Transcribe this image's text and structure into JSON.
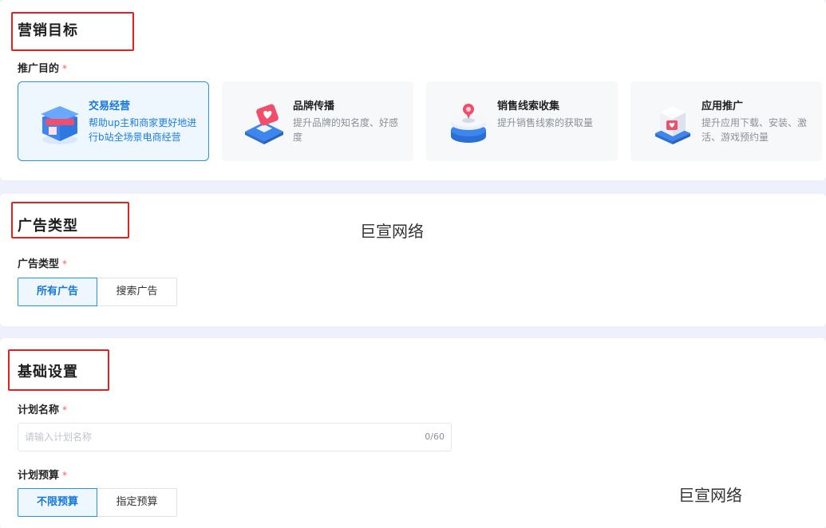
{
  "goal_section": {
    "title": "营销目标",
    "field_label": "推广目的",
    "required_mark": "*",
    "options": [
      {
        "title": "交易经营",
        "desc": "帮助up主和商家更好地进行b站全场景电商经营",
        "selected": true,
        "icon": "box-store-icon"
      },
      {
        "title": "品牌传播",
        "desc": "提升品牌的知名度、好感度",
        "selected": false,
        "icon": "heart-badge-icon"
      },
      {
        "title": "销售线索收集",
        "desc": "提升销售线索的获取量",
        "selected": false,
        "icon": "location-stack-icon"
      },
      {
        "title": "应用推广",
        "desc": "提升应用下载、安装、激活、游戏预约量",
        "selected": false,
        "icon": "app-cube-icon"
      }
    ]
  },
  "type_section": {
    "title": "广告类型",
    "field_label": "广告类型",
    "required_mark": "*",
    "options": [
      "所有广告",
      "搜索广告"
    ],
    "selected": "所有广告"
  },
  "base_section": {
    "title": "基础设置",
    "plan_name_label": "计划名称",
    "plan_name_placeholder": "请输入计划名称",
    "plan_name_value": "",
    "plan_name_counter": "0/60",
    "budget_label": "计划预算",
    "required_mark": "*",
    "budget_options": [
      "不限预算",
      "指定预算"
    ],
    "budget_selected": "不限预算"
  },
  "watermarks": [
    "巨宣网络",
    "巨宣网络"
  ],
  "colors": {
    "accent": "#1677d9",
    "selected_bg": "#eef6fe",
    "annotation_red": "#e5201c",
    "required_red": "#f25f5f"
  }
}
